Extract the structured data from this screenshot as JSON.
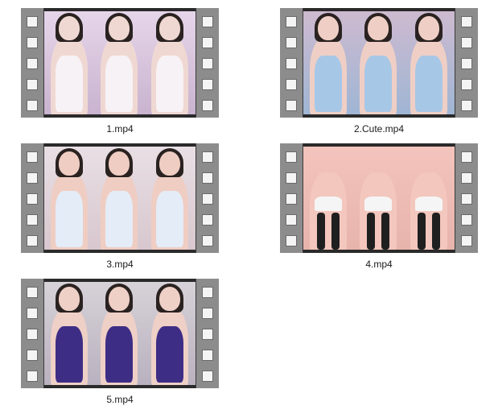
{
  "files": [
    {
      "name": "1.mp4",
      "icon": "video-file-icon",
      "palette": {
        "bg": "#e6d6ea",
        "bg2": "#c9b3cf",
        "skin": "#f0d8d2",
        "outfit": "#f7f2f6",
        "hair": "#2a2220"
      }
    },
    {
      "name": "2.Cute.mp4",
      "icon": "video-file-icon",
      "palette": {
        "bg": "#cdbad0",
        "bg2": "#9fb6d4",
        "skin": "#efcfc5",
        "outfit": "#a7c7e7",
        "hair": "#2a2220"
      }
    },
    {
      "name": "3.mp4",
      "icon": "video-file-icon",
      "palette": {
        "bg": "#e8dfe4",
        "bg2": "#d8c7ce",
        "skin": "#efcdc2",
        "outfit": "#e4ecf7",
        "hair": "#2a2220"
      }
    },
    {
      "name": "4.mp4",
      "icon": "video-file-icon",
      "palette": {
        "bg": "#f3c4bd",
        "bg2": "#e7b4ac",
        "skin": "#f3c7bd",
        "outfit": "#f5f5f5",
        "hair": "#1d1d1d"
      }
    },
    {
      "name": "5.mp4",
      "icon": "video-file-icon",
      "palette": {
        "bg": "#d7d2d8",
        "bg2": "#b9b1bf",
        "skin": "#efd0c6",
        "outfit": "#3e2d84",
        "hair": "#2a2220"
      }
    }
  ]
}
